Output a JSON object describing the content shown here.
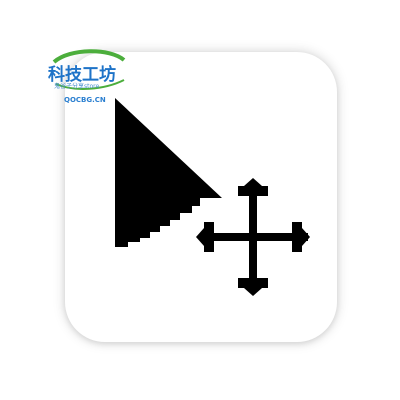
{
  "app_icon": {
    "name": "move-cursor-app-icon",
    "tile_color": "#ffffff",
    "glyph_color": "#000000",
    "icons": [
      "arrow-cursor-icon",
      "move-arrows-icon"
    ]
  },
  "watermark": {
    "title": "科技工坊",
    "subtitle": "鬼谷子分享store",
    "domain": "QOCBG.CN",
    "colors": {
      "green": "#4cae3c",
      "blue": "#1e73c8"
    }
  }
}
